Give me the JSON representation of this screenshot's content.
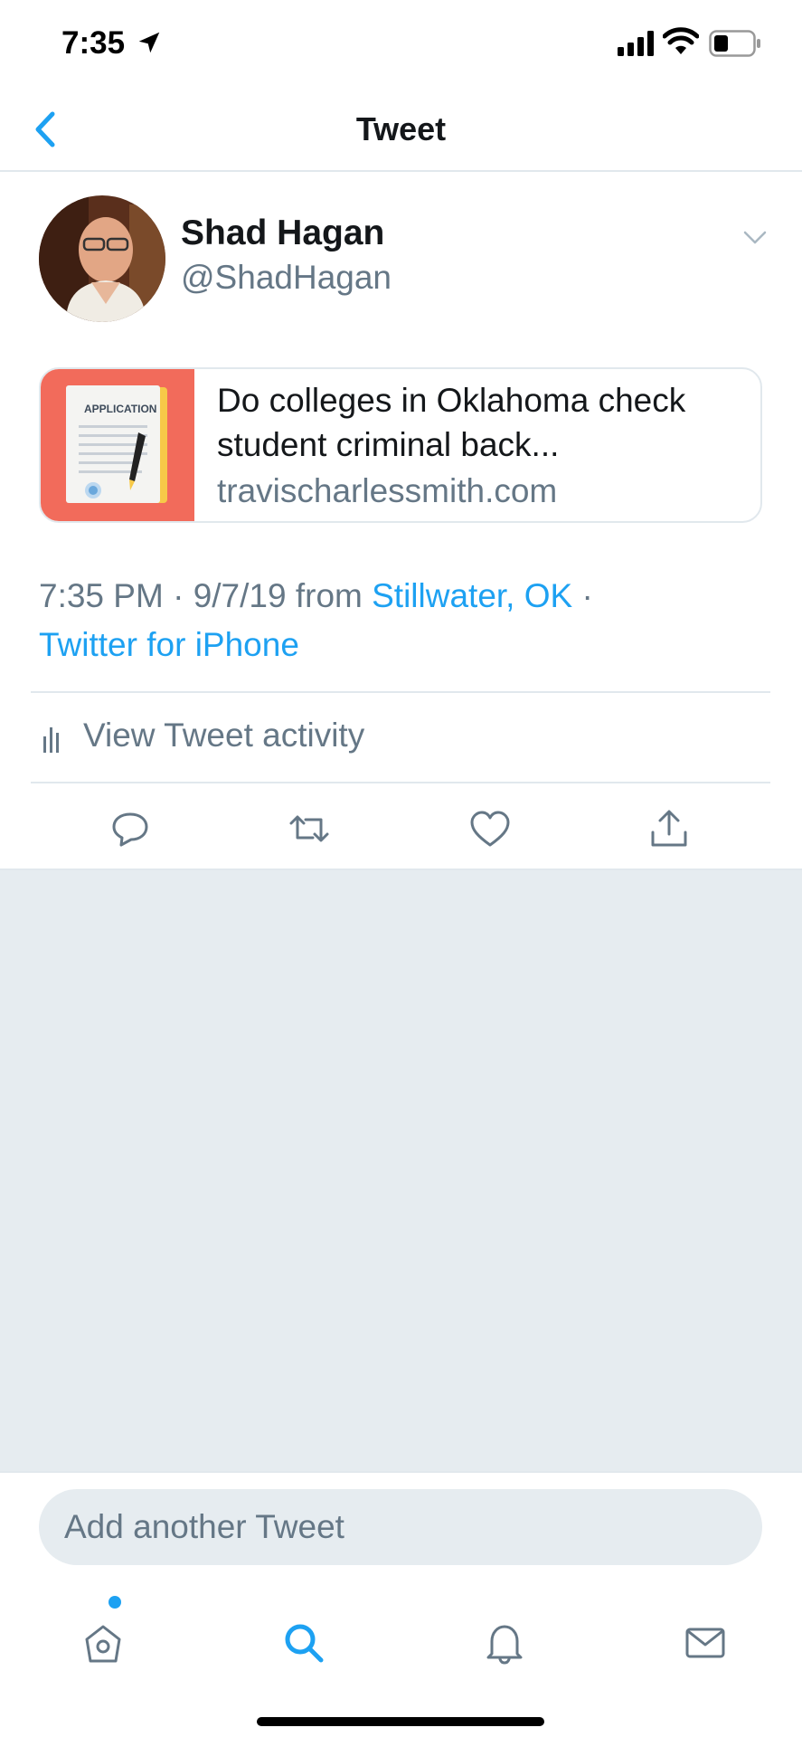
{
  "status_bar": {
    "time": "7:35",
    "icons": [
      "location-arrow-icon",
      "signal-icon",
      "wifi-icon",
      "battery-icon"
    ]
  },
  "nav": {
    "title": "Tweet",
    "back_icon": "chevron-left-icon"
  },
  "tweet": {
    "author_name": "Shad Hagan",
    "author_handle": "@ShadHagan",
    "card": {
      "thumb_label": "APPLICATION",
      "title": "Do colleges in Oklahoma check student criminal back...",
      "domain": "travischarlessmith.com"
    },
    "meta": {
      "time": "7:35 PM",
      "date": "9/7/19",
      "from_label": "from",
      "location": "Stillwater, OK",
      "separator": "·",
      "source": "Twitter for iPhone"
    },
    "activity_label": "View Tweet activity",
    "actions": [
      "reply-icon",
      "retweet-icon",
      "like-icon",
      "share-icon"
    ]
  },
  "composer": {
    "placeholder": "Add another Tweet"
  },
  "tab_bar": {
    "tabs": [
      "home-icon",
      "search-icon",
      "notifications-icon",
      "messages-icon"
    ],
    "active": "search-icon"
  },
  "colors": {
    "accent": "#1da1f2",
    "secondary_text": "#657786",
    "border": "#e1e8ed",
    "background_gray": "#e6ecf0",
    "card_thumb": "#f26b5b"
  }
}
